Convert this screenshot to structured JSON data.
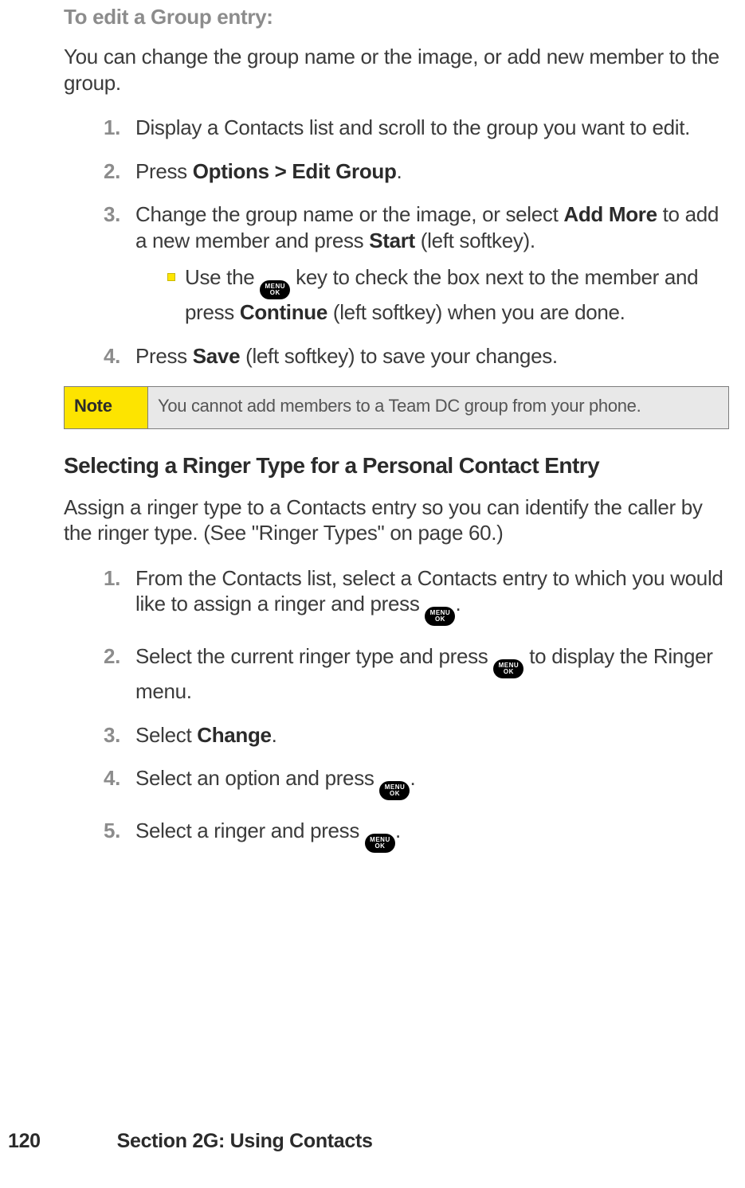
{
  "edit_group": {
    "heading": "To edit a Group entry:",
    "intro": "You can change the group name or the image, or add new member to the group.",
    "steps": {
      "s1": {
        "num": "1.",
        "text": "Display a Contacts list and scroll to the group you want to edit."
      },
      "s2": {
        "num": "2.",
        "pre": "Press ",
        "b1": "Options > Edit Group",
        "post": "."
      },
      "s3": {
        "num": "3.",
        "pre": "Change the group name or the image, or select ",
        "b1": "Add More",
        "mid": " to add a new member and press ",
        "b2": "Start",
        "post": " (left softkey).",
        "sub": {
          "pre": "Use the ",
          "key": "MENU/OK",
          "mid": " key to check the box next to the member and press ",
          "b1": "Continue",
          "post": " (left softkey) when you are done."
        }
      },
      "s4": {
        "num": "4.",
        "pre": "Press ",
        "b1": "Save",
        "post": " (left softkey) to save your changes."
      }
    },
    "note": {
      "label": "Note",
      "text": "You cannot add members to a Team DC group from your phone."
    }
  },
  "ringer": {
    "heading": "Selecting a Ringer Type for a Personal Contact Entry",
    "intro": "Assign a ringer type to a Contacts entry so you can identify the caller by the ringer type. (See \"Ringer Types\" on page 60.)",
    "steps": {
      "s1": {
        "num": "1.",
        "pre": "From the Contacts list, select a Contacts entry to which you would like to assign a ringer and press ",
        "post": "."
      },
      "s2": {
        "num": "2.",
        "pre": "Select the current ringer type and press ",
        "post": " to display the Ringer menu."
      },
      "s3": {
        "num": "3.",
        "pre": "Select ",
        "b1": "Change",
        "post": "."
      },
      "s4": {
        "num": "4.",
        "pre": "Select an option and press ",
        "post": "."
      },
      "s5": {
        "num": "5.",
        "pre": "Select a ringer and press ",
        "post": "."
      }
    }
  },
  "key_label": {
    "line1": "MENU",
    "line2": "OK"
  },
  "footer": {
    "page": "120",
    "text": "Section 2G: Using Contacts"
  }
}
